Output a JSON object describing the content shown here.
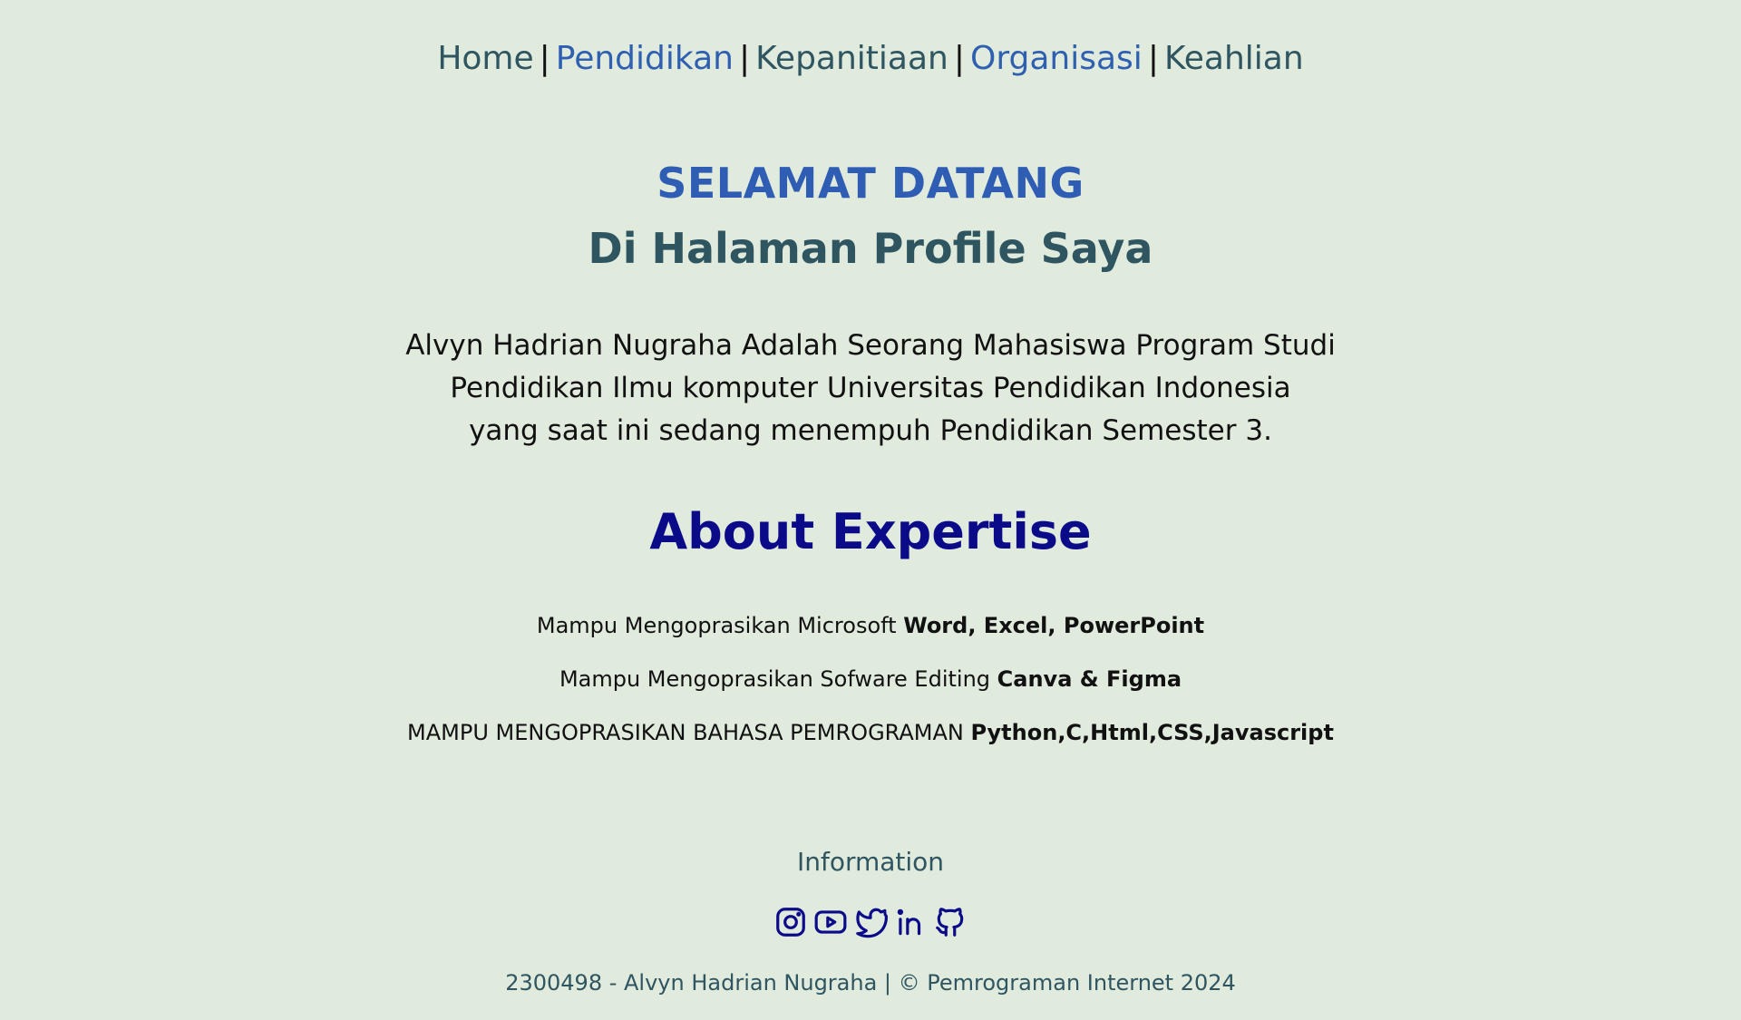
{
  "nav": {
    "items": [
      {
        "label": "Home",
        "color": "#2e5560"
      },
      {
        "label": "Pendidikan",
        "color": "#2f5fb0"
      },
      {
        "label": "Kepanitiaan",
        "color": "#2e5560"
      },
      {
        "label": "Organisasi",
        "color": "#2f5fb0"
      },
      {
        "label": "Keahlian",
        "color": "#2e5560"
      }
    ],
    "separator": "|"
  },
  "hero": {
    "title": "SELAMAT DATANG",
    "subtitle": "Di Halaman Profile Saya"
  },
  "intro": {
    "line1": "Alvyn Hadrian Nugraha Adalah Seorang Mahasiswa Program Studi",
    "line2": "Pendidikan Ilmu komputer Universitas Pendidikan Indonesia",
    "line3": "yang saat ini sedang menempuh Pendidikan Semester 3."
  },
  "about": {
    "title": "About Expertise",
    "skills": [
      {
        "text": "Mampu Mengoprasikan Microsoft ",
        "bold": "Word, Excel, PowerPoint"
      },
      {
        "text": "Mampu Mengoprasikan Sofware Editing ",
        "bold": "Canva & Figma"
      },
      {
        "text": "MAMPU MENGOPRASIKAN BAHASA PEMROGRAMAN ",
        "bold": "Python,C,Html,CSS,Javascript"
      }
    ]
  },
  "footer": {
    "info_title": "Information",
    "socials": [
      "instagram-icon",
      "youtube-icon",
      "twitter-icon",
      "linkedin-icon",
      "github-icon"
    ],
    "icon_color": "#0b0b8a",
    "copyright": "2300498 - Alvyn Hadrian Nugraha | © Pemrograman Internet 2024"
  },
  "colors": {
    "background": "#e0eadd",
    "accent_blue": "#2e5db3",
    "dark_teal": "#2e5560",
    "navy": "#0b0b8a"
  }
}
